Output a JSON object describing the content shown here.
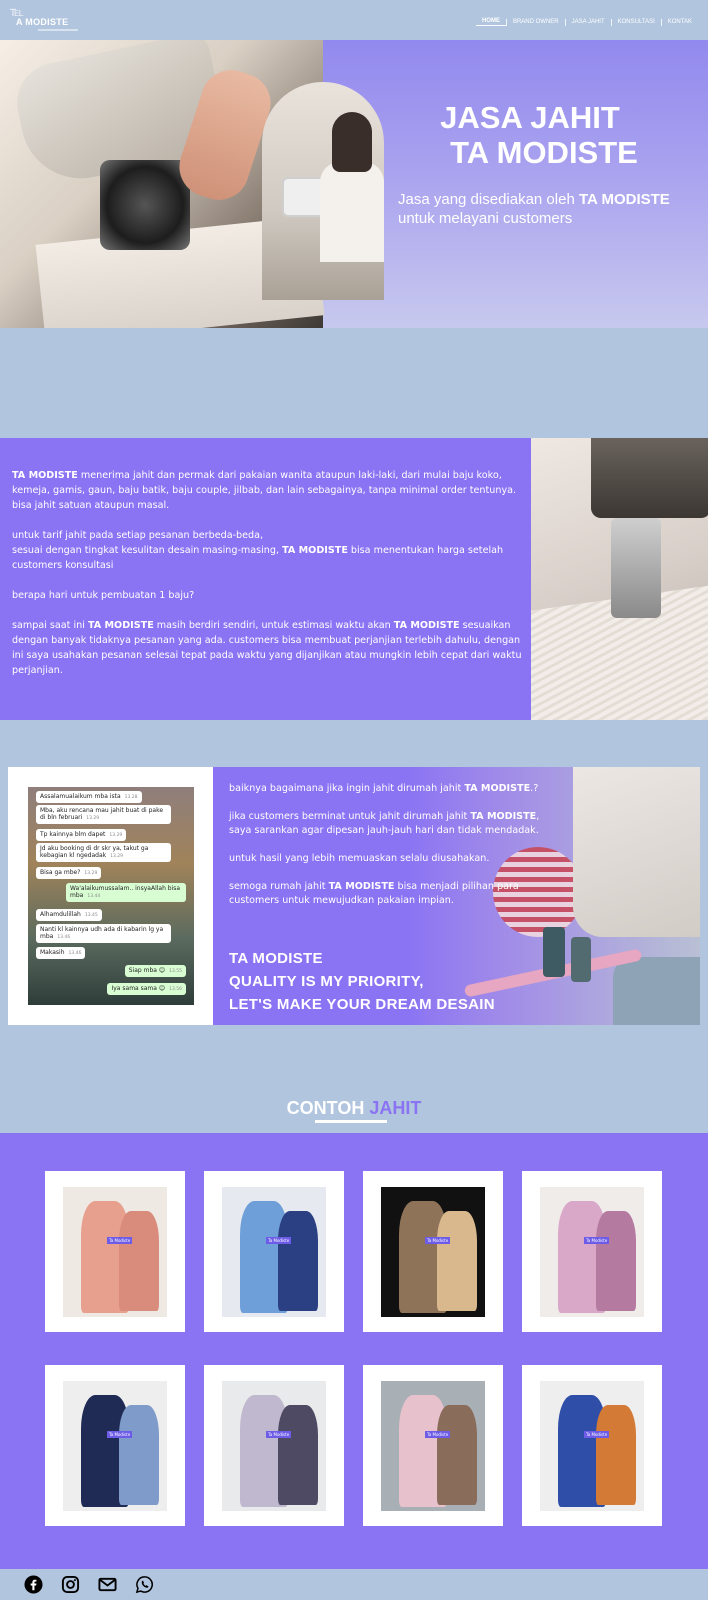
{
  "nav": {
    "logo_mark": "℡",
    "logo_text": "A MODISTE",
    "items": [
      "HOME",
      "BRAND OWNER",
      "JASA JAHIT",
      "KONSULTASI",
      "KONTAK"
    ]
  },
  "hero": {
    "title_line1": "JASA JAHIT",
    "title_line2": "TA MODISTE",
    "subtitle_prefix": "Jasa yang disediakan oleh ",
    "subtitle_bold": "TA MODISTE",
    "subtitle_suffix": " untuk melayani customers"
  },
  "about": {
    "p1_bold": "TA MODISTE",
    "p1_rest": " menerima jahit dan permak dari pakaian wanita ataupun laki-laki, dari mulai baju koko, kemeja, gamis, gaun, baju batik, baju couple, jilbab, dan lain sebagainya, tanpa minimal order tentunya. bisa jahit satuan ataupun masal.",
    "p2_a": "untuk tarif jahit pada setiap pesanan berbeda-beda,",
    "p2_b": "sesuai dengan tingkat kesulitan desain masing-masing, ",
    "p2_bold": "TA MODISTE",
    "p2_c": " bisa menentukan harga setelah customers konsultasi",
    "p3": "berapa hari untuk pembuatan 1 baju?",
    "p4_a": "sampai saat ini ",
    "p4_bold1": "TA MODISTE",
    "p4_b": " masih berdiri sendiri, untuk estimasi waktu akan ",
    "p4_bold2": "TA MODISTE",
    "p4_c": " sesuaikan dengan banyak tidaknya pesanan yang ada. customers bisa membuat perjanjian terlebih dahulu, dengan ini saya usahakan pesanan selesai tepat pada waktu yang dijanjikan atau mungkin lebih cepat dari waktu perjanjian."
  },
  "chat": {
    "messages": [
      {
        "text": "Assalamualaikum mba ista",
        "time": "13.28",
        "me": false
      },
      {
        "text": "Mba, aku rencana mau jahit buat di pake di bln februari",
        "time": "13.29",
        "me": false
      },
      {
        "text": "Tp kainnya blm dapet",
        "time": "13.29",
        "me": false
      },
      {
        "text": "Jd aku booking di dr skr ya, takut ga kebagian kl ngedadak",
        "time": "13.29",
        "me": false
      },
      {
        "text": "Bisa ga mbe?",
        "time": "13.29",
        "me": false
      },
      {
        "text": "Wa'alaikumussalam.. insyaAllah bisa mba",
        "time": "13.44",
        "me": true
      },
      {
        "text": "Alhamdulillah",
        "time": "13.45",
        "me": false
      },
      {
        "text": "Nanti kl kainnya udh ada di kabarin lg ya mba",
        "time": "13.46",
        "me": false
      },
      {
        "text": "Makasih",
        "time": "13.46",
        "me": false
      },
      {
        "text": "Siap mba 😊",
        "time": "13.55",
        "me": true
      },
      {
        "text": "Iya sama sama 😊",
        "time": "13.56",
        "me": true
      }
    ]
  },
  "promo": {
    "p1_a": "baiknya bagaimana jika ingin jahit dirumah jahit ",
    "p1_bold": "TA MODISTE",
    "p1_b": ".?",
    "p2_a": "jika customers berminat untuk jahit dirumah jahit ",
    "p2_bold": "TA MODISTE",
    "p2_b": ", saya sarankan agar dipesan jauh-jauh hari dan tidak mendadak.",
    "p3": "untuk hasil yang lebih memuaskan selalu diusahakan.",
    "p4_a": "semoga rumah jahit ",
    "p4_bold": "TA MODISTE",
    "p4_b": " bisa menjadi pilihan para customers untuk mewujudkan pakaian impian.",
    "slogan1": "TA MODISTE",
    "slogan2": "QUALITY IS MY PRIORITY,",
    "slogan3": "LET'S MAKE YOUR DREAM DESAIN"
  },
  "contoh": {
    "title_a": "CONTOH ",
    "title_b": "JAHIT",
    "items": [
      {
        "label": "Ta Modiste",
        "colors": [
          "#e8a08e",
          "#d98b7c"
        ]
      },
      {
        "label": "Ta Modiste",
        "colors": [
          "#6f9fd8",
          "#2b3f83"
        ]
      },
      {
        "label": "Ta Modiste",
        "colors": [
          "#8f7358",
          "#d9b88e"
        ]
      },
      {
        "label": "Ta Modiste",
        "colors": [
          "#d9a7c8",
          "#b57aa0"
        ]
      },
      {
        "label": "Ta Modiste",
        "colors": [
          "#1f2a55",
          "#7f9bc9"
        ]
      },
      {
        "label": "Ta Modiste",
        "colors": [
          "#bfb8cf",
          "#4e4a63"
        ]
      },
      {
        "label": "Ta Modiste",
        "colors": [
          "#e7c1cc",
          "#8a6c5a"
        ]
      },
      {
        "label": "Ta Modiste",
        "colors": [
          "#2f4ea8",
          "#d37a36"
        ]
      }
    ]
  },
  "footer": {
    "icons": [
      "facebook-icon",
      "instagram-icon",
      "mail-icon",
      "whatsapp-icon"
    ]
  }
}
